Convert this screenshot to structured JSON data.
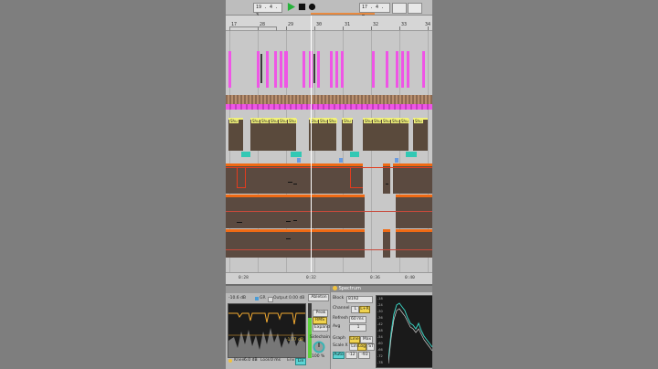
{
  "transport": {
    "tempo": "19 . 4 . 3",
    "position": "17 . 4 . 4"
  },
  "ruler": {
    "bars": [
      "17",
      "28",
      "29",
      "30",
      "31",
      "32",
      "33",
      "34"
    ]
  },
  "arrangement": {
    "clip_labels": [
      "Shu",
      "Shu",
      "Shu",
      "Shu",
      "Shu",
      "Shu",
      "Shu",
      "Shu",
      "Shu",
      "Shu",
      "Shu",
      "Shu",
      "Shu",
      "Shu",
      "Shu",
      "Shu"
    ]
  },
  "time_ruler": {
    "marks": [
      "0:28",
      "0:32",
      "0:36",
      "0:40"
    ]
  },
  "compressor": {
    "threshold": "-10.6 dB",
    "gr_label": "GR",
    "output_label": "Output",
    "out_value": "0.00 dB",
    "gain_value": "-1.77 dB",
    "knee_label": "Knee",
    "knee": "6.0 dB",
    "look_label": "Look",
    "look": "0 ms",
    "env_label": "Env",
    "env": "Lin",
    "mode": "Ableton",
    "peak": "Peak",
    "rms": "RMS",
    "expand": "Expand",
    "sidechain_label": "Sidechain",
    "dry_wet": "100 %"
  },
  "spectrum": {
    "title": "Spectrum",
    "block_label": "Block",
    "block": "8192",
    "channel_label": "Channel",
    "channel_l": "L",
    "channel_lr": "L+R",
    "refresh_label": "Refresh",
    "refresh": "60 ms",
    "avg_label": "Avg",
    "avg": "1",
    "graph_label": "Graph",
    "graph_line": "Line",
    "graph_max": "Max",
    "scale_x_label": "Scale X",
    "scale_x_lin": "Lin",
    "scale_x_log": "Log",
    "scale_x_st": "ST",
    "auto": "Auto",
    "range_1": "-12",
    "range_2": "-93",
    "y_labels": [
      "-18",
      "-24",
      "-30",
      "-36",
      "-42",
      "-48",
      "-54",
      "-60",
      "-66",
      "-72",
      "-78"
    ]
  },
  "colors": {
    "midi_clip": "#ef55e6",
    "drum_clip_header": "#f2f27a",
    "orange_clip": "#f06a14",
    "cyan_clip": "#32c8b4",
    "automation": "#e33c1e"
  }
}
